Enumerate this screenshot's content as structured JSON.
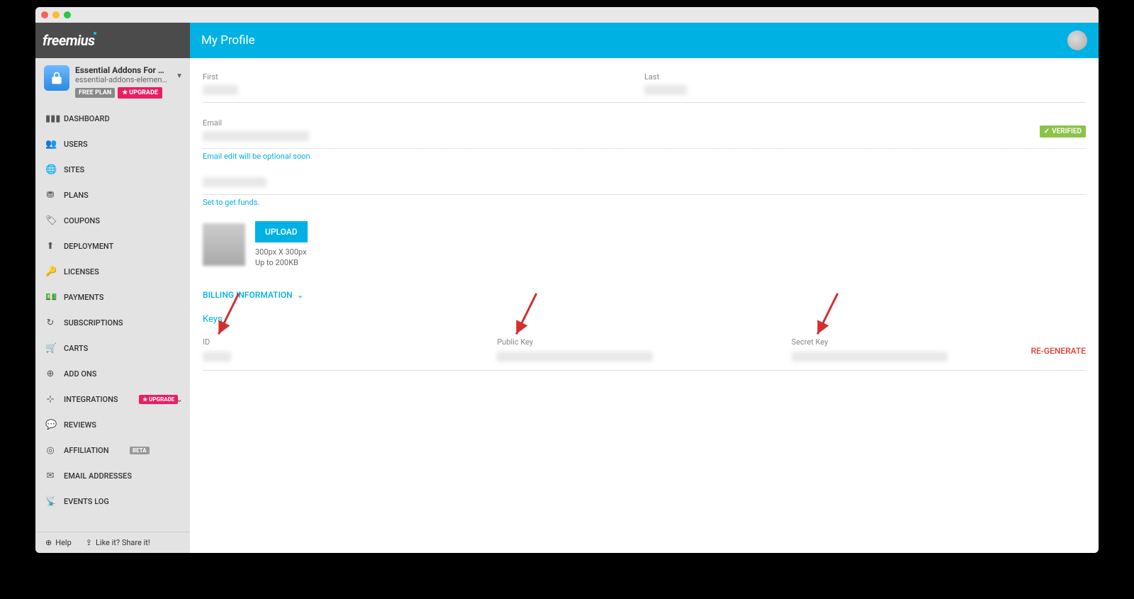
{
  "brand": "freemius",
  "plugin": {
    "name": "Essential Addons For …",
    "slug": "essential-addons-elemen…",
    "plan_badge": "FREE PLAN",
    "upgrade": "UPGRADE"
  },
  "nav": {
    "dashboard": "DASHBOARD",
    "users": "USERS",
    "sites": "SITES",
    "plans": "PLANS",
    "coupons": "COUPONS",
    "deployment": "DEPLOYMENT",
    "licenses": "LICENSES",
    "payments": "PAYMENTS",
    "subscriptions": "SUBSCRIPTIONS",
    "carts": "CARTS",
    "addons": "ADD ONS",
    "integrations": "INTEGRATIONS",
    "integrations_badge": "UPGRADE",
    "reviews": "REVIEWS",
    "affiliation": "AFFILIATION",
    "affiliation_badge": "BETA",
    "email_addresses": "EMAIL ADDRESSES",
    "events_log": "EVENTS LOG"
  },
  "footer": {
    "help": "Help",
    "share": "Like it? Share it!"
  },
  "header": {
    "title": "My Profile"
  },
  "profile": {
    "first_label": "First",
    "last_label": "Last",
    "email_label": "Email",
    "email_hint": "Email edit will be optional soon.",
    "paypal_hint": "Set to get funds.",
    "upload": "UPLOAD",
    "upload_size": "300px X 300px",
    "upload_limit": "Up to 200KB",
    "verified": "VERIFIED"
  },
  "billing": {
    "title": "BILLING INFORMATION"
  },
  "keys": {
    "title": "Keys",
    "id_label": "ID",
    "public_label": "Public Key",
    "secret_label": "Secret Key",
    "regenerate": "RE-GENERATE"
  }
}
